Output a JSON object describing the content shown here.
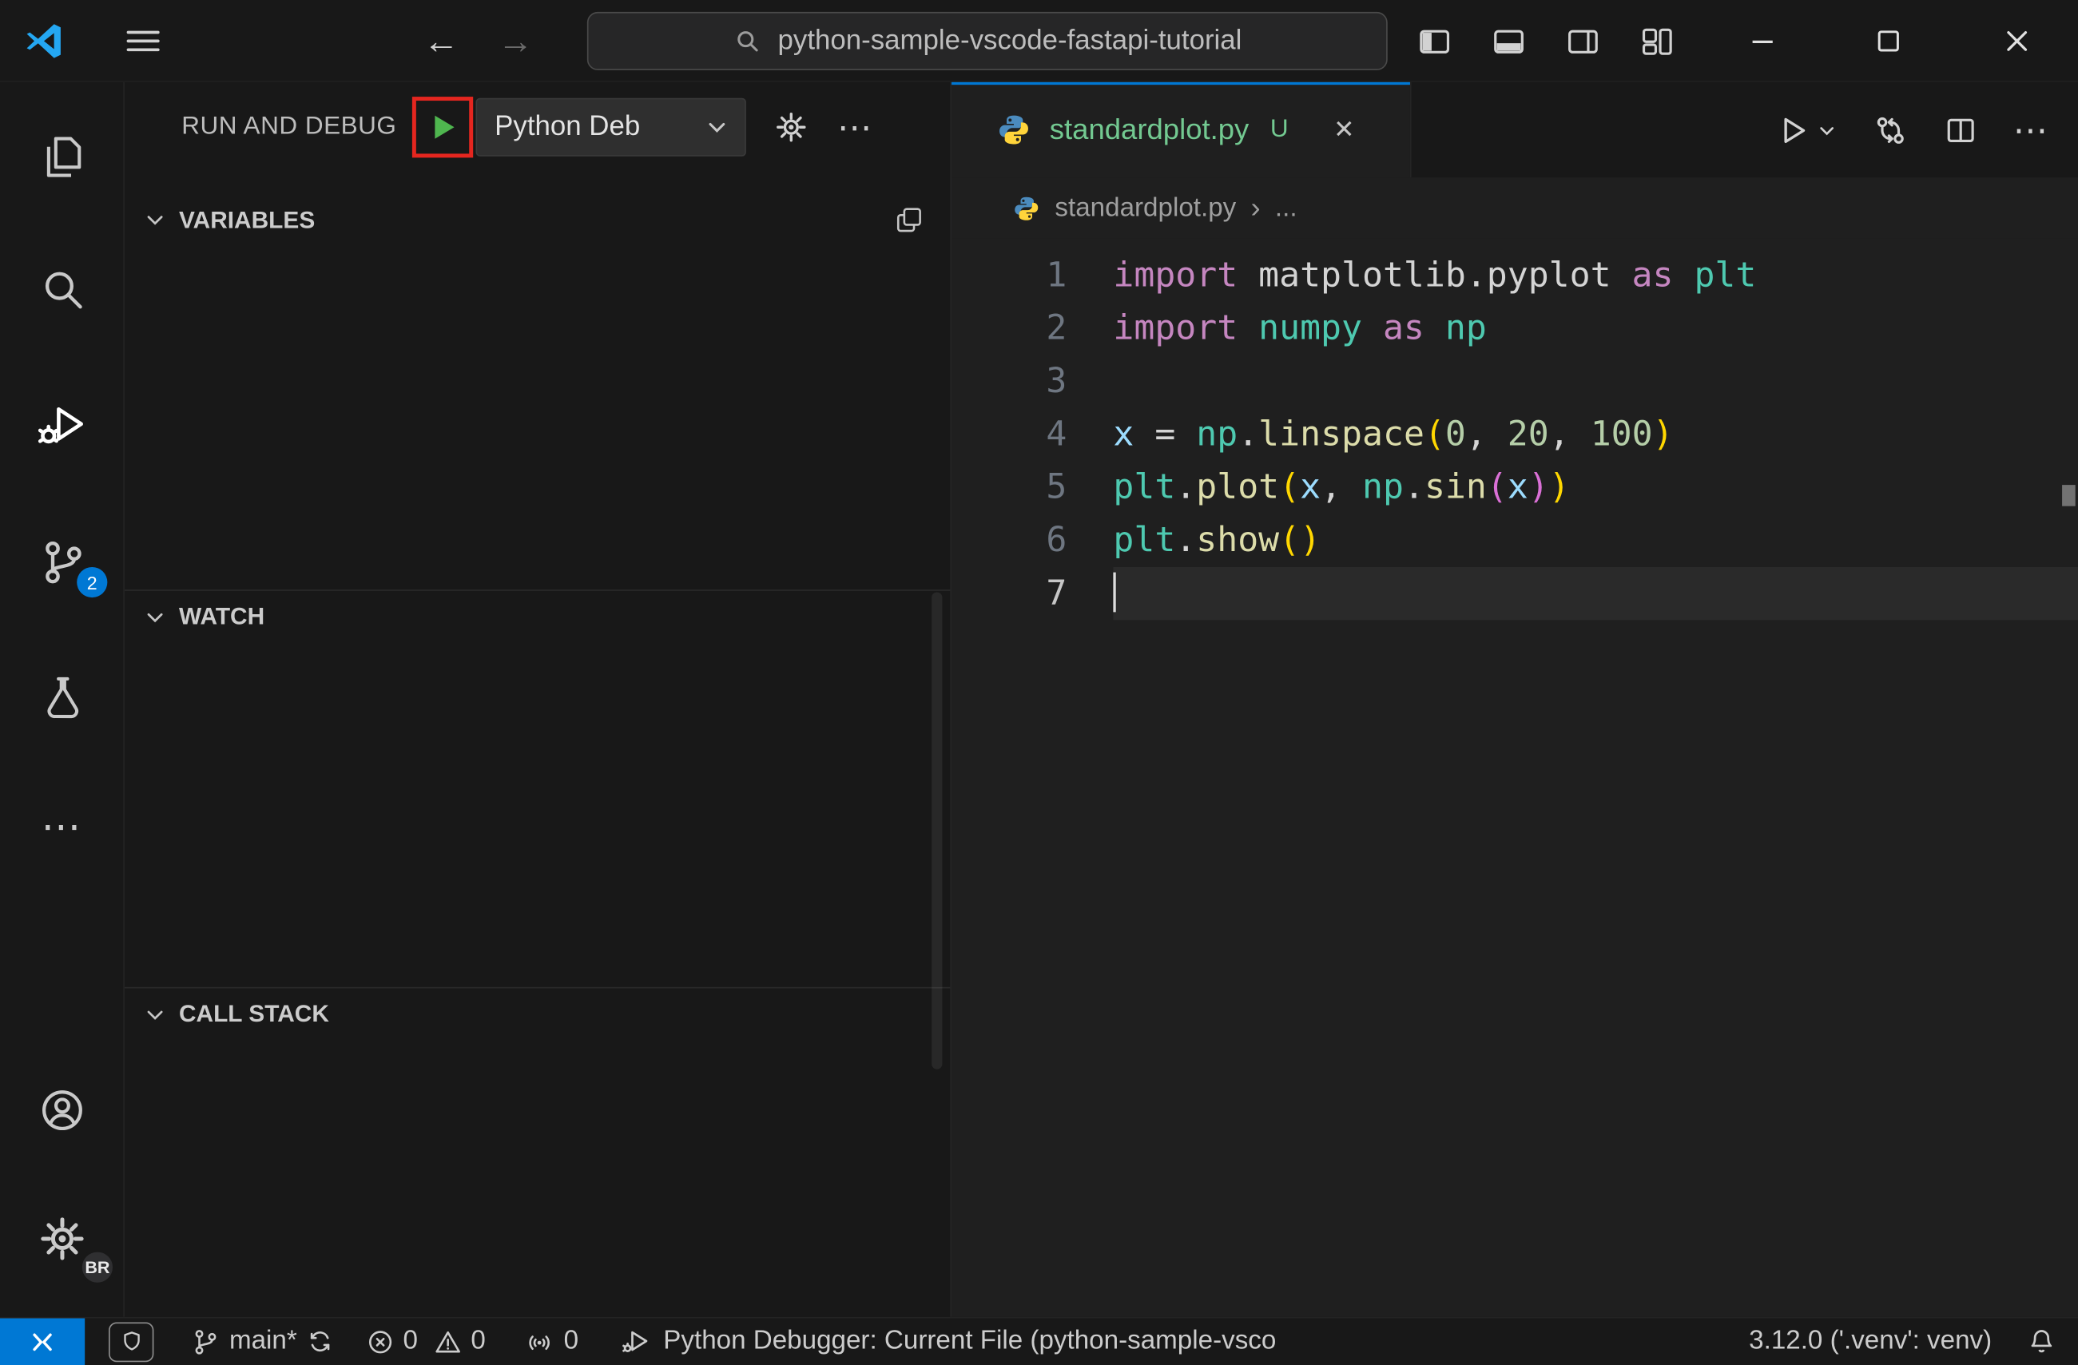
{
  "titlebar": {
    "search_value": "python-sample-vscode-fastapi-tutorial"
  },
  "activity_bar": {
    "scm_badge": "2",
    "profile_badge": "BR"
  },
  "sidebar": {
    "title": "RUN AND DEBUG",
    "debug_config_label": "Python Deb",
    "sections": {
      "variables": "VARIABLES",
      "watch": "WATCH",
      "call_stack": "CALL STACK"
    }
  },
  "editor": {
    "tab_label": "standardplot.py",
    "tab_modified_badge": "U",
    "breadcrumb_file": "standardplot.py",
    "breadcrumb_symbol": "...",
    "cursor_line": 7,
    "code_lines": [
      {
        "num": 1,
        "tokens": [
          {
            "t": "import",
            "c": "kw"
          },
          {
            "t": " matplotlib.pyplot",
            "c": "plain"
          },
          {
            "t": " as",
            "c": "kw"
          },
          {
            "t": " plt",
            "c": "ns"
          }
        ]
      },
      {
        "num": 2,
        "tokens": [
          {
            "t": "import",
            "c": "kw"
          },
          {
            "t": " numpy",
            "c": "ns"
          },
          {
            "t": " as",
            "c": "kw"
          },
          {
            "t": " np",
            "c": "ns"
          }
        ]
      },
      {
        "num": 3,
        "tokens": []
      },
      {
        "num": 4,
        "tokens": [
          {
            "t": "x",
            "c": "var"
          },
          {
            "t": " = ",
            "c": "plain"
          },
          {
            "t": "np",
            "c": "ns"
          },
          {
            "t": ".",
            "c": "plain"
          },
          {
            "t": "linspace",
            "c": "fn"
          },
          {
            "t": "(",
            "c": "b1"
          },
          {
            "t": "0",
            "c": "num"
          },
          {
            "t": ", ",
            "c": "plain"
          },
          {
            "t": "20",
            "c": "num"
          },
          {
            "t": ", ",
            "c": "plain"
          },
          {
            "t": "100",
            "c": "num"
          },
          {
            "t": ")",
            "c": "b1"
          }
        ]
      },
      {
        "num": 5,
        "tokens": [
          {
            "t": "plt",
            "c": "ns"
          },
          {
            "t": ".",
            "c": "plain"
          },
          {
            "t": "plot",
            "c": "fn"
          },
          {
            "t": "(",
            "c": "b1"
          },
          {
            "t": "x",
            "c": "var"
          },
          {
            "t": ", ",
            "c": "plain"
          },
          {
            "t": "np",
            "c": "ns"
          },
          {
            "t": ".",
            "c": "plain"
          },
          {
            "t": "sin",
            "c": "fn"
          },
          {
            "t": "(",
            "c": "b2"
          },
          {
            "t": "x",
            "c": "var"
          },
          {
            "t": ")",
            "c": "b2"
          },
          {
            "t": ")",
            "c": "b1"
          }
        ]
      },
      {
        "num": 6,
        "tokens": [
          {
            "t": "plt",
            "c": "ns"
          },
          {
            "t": ".",
            "c": "plain"
          },
          {
            "t": "show",
            "c": "fn"
          },
          {
            "t": "(",
            "c": "b1"
          },
          {
            "t": ")",
            "c": "b1"
          }
        ]
      },
      {
        "num": 7,
        "tokens": []
      }
    ]
  },
  "status_bar": {
    "branch": "main*",
    "errors": "0",
    "warnings": "0",
    "ports": "0",
    "debugger_label": "Python Debugger: Current File (python-sample-vsco",
    "python_version": "3.12.0 ('.venv': venv)"
  },
  "icons": {
    "back": "←",
    "forward": "→",
    "ellipsis": "⋯",
    "close": "✕",
    "chevron_right": "›"
  },
  "colors": {
    "accent_blue": "#0078d4",
    "badge_blue": "#0078d4",
    "logo_blue": "#24a7f2",
    "annotation_red": "#e5261f",
    "run_green": "#4fb64f",
    "untracked_green": "#73C991",
    "python_icon_blue": "#4B8BBE",
    "python_icon_yellow": "#FFD43B",
    "token_kw": "#C586C0",
    "token_ns": "#4EC9B0",
    "token_fn": "#DCDCAA",
    "token_var": "#9CDCFE",
    "token_num": "#B5CEA8",
    "token_plain": "#D4D4D4",
    "token_b1": "#FFD700",
    "token_b2": "#DA70D6"
  }
}
